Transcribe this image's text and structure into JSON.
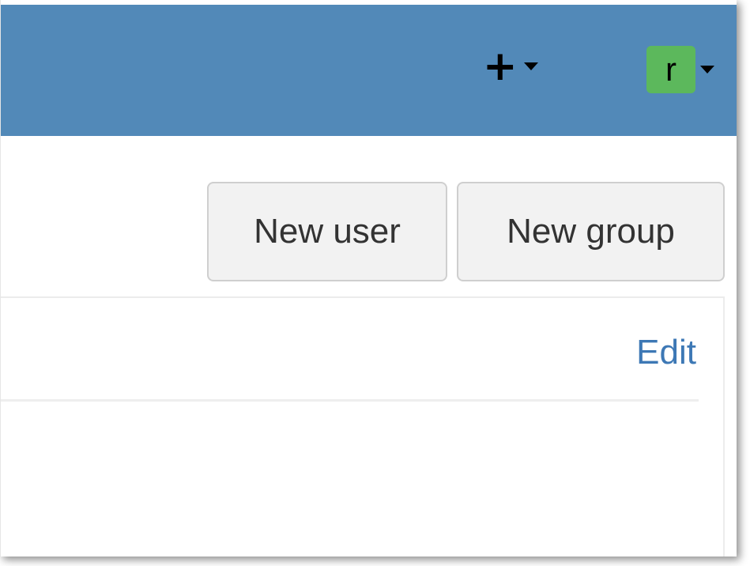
{
  "header": {
    "create_menu_icon": "plus-icon",
    "user_avatar_letter": "r",
    "colors": {
      "bar": "#5289b8",
      "avatar": "#5cb85c"
    }
  },
  "toolbar": {
    "new_user_label": "New user",
    "new_group_label": "New group"
  },
  "panel": {
    "edit_label": "Edit",
    "link_color": "#3d78b5"
  }
}
